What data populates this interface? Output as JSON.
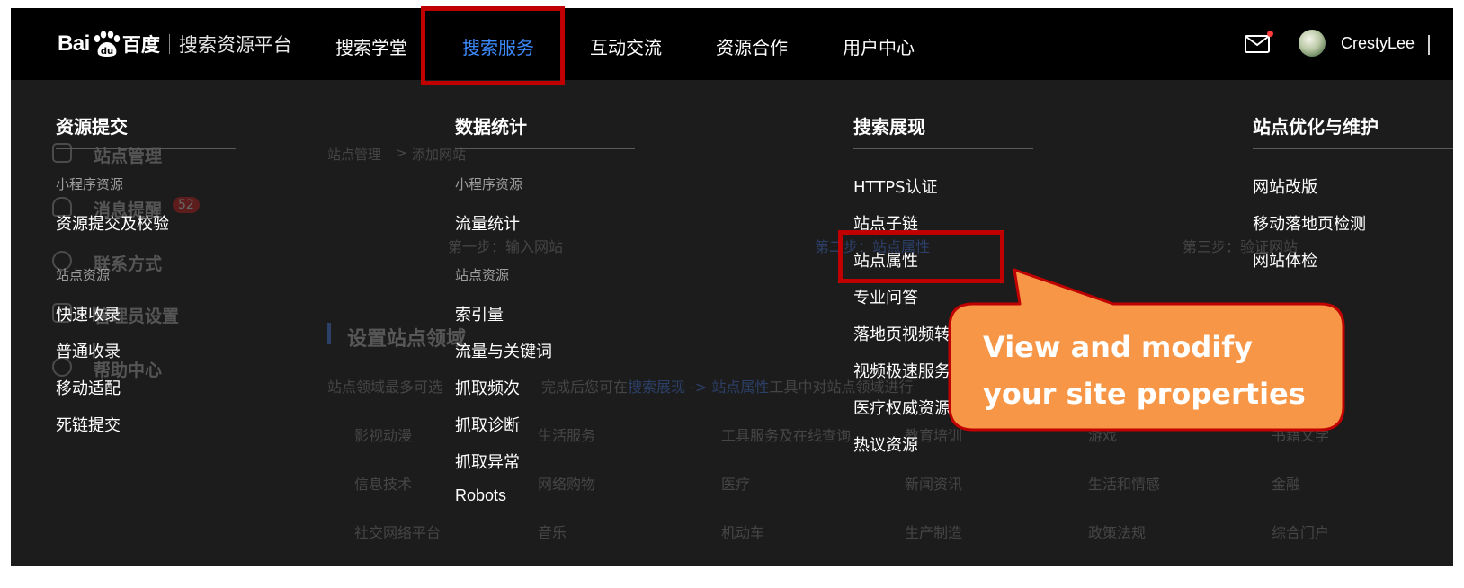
{
  "header": {
    "logo": {
      "bai": "Bai",
      "paw_icon": "baidu-paw-icon",
      "du": "百度",
      "platform": "搜索资源平台"
    },
    "nav": [
      {
        "label": "搜索学堂",
        "active": false
      },
      {
        "label": "搜索服务",
        "active": true
      },
      {
        "label": "互动交流",
        "active": false
      },
      {
        "label": "资源合作",
        "active": false
      },
      {
        "label": "用户中心",
        "active": false
      }
    ],
    "mail_icon": "mail-icon",
    "username": "CrestyLee"
  },
  "menu": {
    "columns": [
      {
        "title": "资源提交",
        "groups": [
          {
            "category": "小程序资源",
            "links": [
              "资源提交及校验"
            ]
          },
          {
            "category": "站点资源",
            "links": [
              "快速收录",
              "普通收录",
              "移动适配",
              "死链提交"
            ]
          }
        ]
      },
      {
        "title": "数据统计",
        "groups": [
          {
            "category": "小程序资源",
            "links": [
              "流量统计"
            ]
          },
          {
            "category": "站点资源",
            "links": [
              "索引量",
              "流量与关键词",
              "抓取频次",
              "抓取诊断",
              "抓取异常",
              "Robots"
            ]
          }
        ]
      },
      {
        "title": "搜索展现",
        "links": [
          "HTTPS认证",
          "站点子链",
          "站点属性",
          "专业问答",
          "落地页视频转",
          "视频极速服务",
          "医疗权威资源",
          "热议资源"
        ]
      },
      {
        "title": "站点优化与维护",
        "links": [
          "网站改版",
          "移动落地页检测",
          "网站体检"
        ]
      }
    ]
  },
  "background": {
    "sidebar": [
      {
        "label": "站点管理",
        "icon": "site-icon"
      },
      {
        "label": "消息提醒",
        "icon": "bell-icon",
        "badge": "52"
      },
      {
        "label": "联系方式",
        "icon": "phone-icon"
      },
      {
        "label": "管理员设置",
        "icon": "admin-icon"
      },
      {
        "label": "帮助中心",
        "icon": "help-icon"
      }
    ],
    "breadcrumb": [
      "站点管理",
      ">",
      "添加网站"
    ],
    "steps": [
      "第一步：输入网站",
      "第二步：站点属性",
      "第三步：验证网站"
    ],
    "section_title": "设置站点领域",
    "desc_prefix": "站点领域最多可选",
    "desc_mid": "完成后您可在",
    "desc_link1": "搜索展现",
    "desc_arrow": "->",
    "desc_link2": "站点属性",
    "desc_suffix": "工具中对站点领域进行",
    "domains": [
      [
        "影视动漫",
        "生活服务",
        "工具服务及在线查询",
        "教育培训",
        "游戏",
        "书籍文学"
      ],
      [
        "信息技术",
        "网络购物",
        "医疗",
        "新闻资讯",
        "生活和情感",
        "金融"
      ],
      [
        "社交网络平台",
        "音乐",
        "机动车",
        "生产制造",
        "政策法规",
        "综合门户"
      ]
    ]
  },
  "callout": {
    "line1": "View and modify",
    "line2": "your site properties",
    "color": "#F79646",
    "border": "#C00000"
  }
}
